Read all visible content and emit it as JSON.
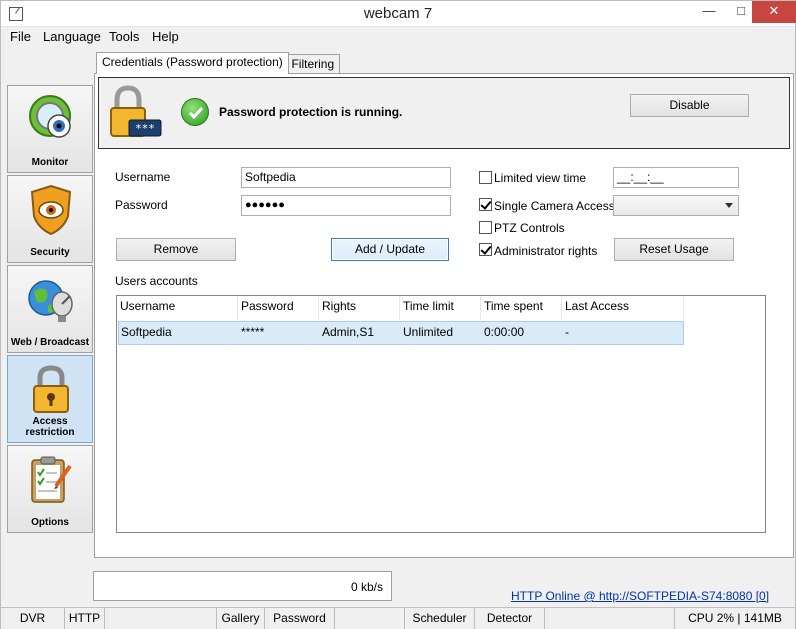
{
  "window": {
    "title": "webcam 7"
  },
  "menu": {
    "file": "File",
    "language": "Language",
    "tools": "Tools",
    "help": "Help"
  },
  "sidebar": {
    "items": [
      {
        "label": "Monitor",
        "icon": "monitor-icon"
      },
      {
        "label": "Security",
        "icon": "shield-icon"
      },
      {
        "label": "Web / Broadcast",
        "icon": "globe-icon"
      },
      {
        "label": "Access restriction",
        "icon": "lock-icon"
      },
      {
        "label": "Options",
        "icon": "clipboard-icon"
      }
    ]
  },
  "tabs": {
    "credentials": "Credentials (Password protection)",
    "ip_filtering": "IP Filtering"
  },
  "status": {
    "message": "Password protection is running.",
    "disable_label": "Disable"
  },
  "form": {
    "username_label": "Username",
    "username_value": "Softpedia",
    "password_label": "Password",
    "password_value": "●●●●●●",
    "limited_view_time_label": "Limited view time",
    "limited_view_time_value": "__:__:__",
    "single_camera_access_label": "Single Camera Access",
    "ptz_controls_label": "PTZ Controls",
    "administrator_rights_label": "Administrator rights",
    "remove_label": "Remove",
    "add_update_label": "Add / Update",
    "reset_usage_label": "Reset Usage",
    "users_accounts_label": "Users accounts"
  },
  "table": {
    "headers": [
      "Username",
      "Password",
      "Rights",
      "Time limit",
      "Time spent",
      "Last Access"
    ],
    "rows": [
      [
        "Softpedia",
        "*****",
        "Admin,S1",
        "Unlimited",
        "0:00:00",
        "-"
      ]
    ]
  },
  "bottom": {
    "rate": "0 kb/s",
    "http_status": "HTTP Online @ http://SOFTPEDIA-S74:8080 [0]"
  },
  "statusbar": {
    "dvr": "DVR",
    "http": "HTTP",
    "gallery": "Gallery",
    "password": "Password",
    "scheduler": "Scheduler",
    "detector": "Detector",
    "cpu": "CPU 2% | 141MB"
  }
}
